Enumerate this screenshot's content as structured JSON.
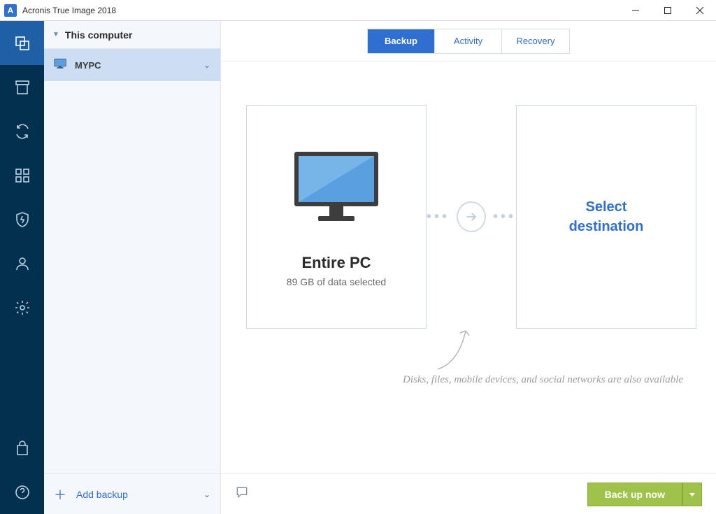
{
  "window": {
    "title": "Acronis True Image 2018",
    "app_initial": "A"
  },
  "nav": {
    "items": [
      {
        "name": "backup-nav"
      },
      {
        "name": "archive-nav"
      },
      {
        "name": "sync-nav"
      },
      {
        "name": "dashboard-nav"
      },
      {
        "name": "protection-nav"
      },
      {
        "name": "account-nav"
      },
      {
        "name": "settings-nav"
      }
    ],
    "bottom": [
      {
        "name": "store-nav"
      },
      {
        "name": "help-nav"
      }
    ]
  },
  "list": {
    "header": "This computer",
    "items": [
      {
        "name": "MYPC"
      }
    ],
    "add_label": "Add backup"
  },
  "tabs": {
    "items": [
      "Backup",
      "Activity",
      "Recovery"
    ],
    "active_index": 0
  },
  "source": {
    "title": "Entire PC",
    "subtitle": "89 GB of data selected"
  },
  "destination": {
    "line1": "Select",
    "line2": "destination"
  },
  "hint": "Disks, files, mobile devices, and social networks are also available",
  "footer": {
    "backup_label": "Back up now"
  }
}
